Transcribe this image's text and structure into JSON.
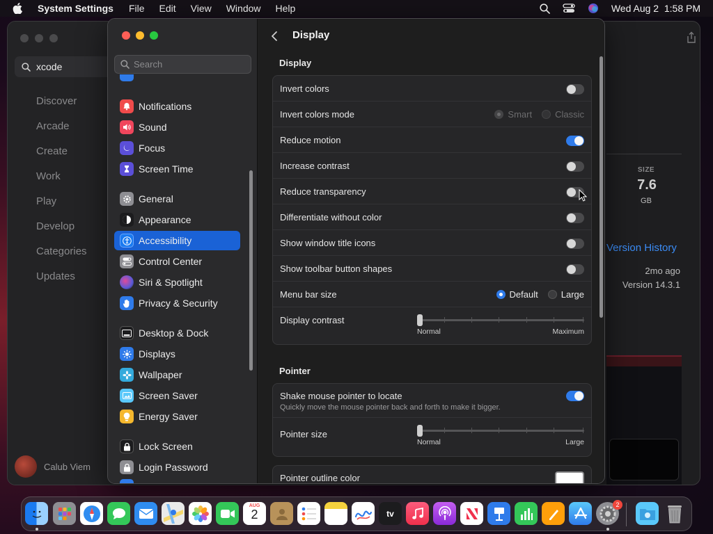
{
  "menubar": {
    "app_name": "System Settings",
    "items": [
      "File",
      "Edit",
      "View",
      "Window",
      "Help"
    ],
    "datetime": "Wed Aug 2  1:58 PM"
  },
  "background_window": {
    "search_value": "xcode",
    "nav": [
      "Discover",
      "Arcade",
      "Create",
      "Work",
      "Play",
      "Develop",
      "Categories",
      "Updates"
    ],
    "user_name": "Calub Viem",
    "size_label": "SIZE",
    "size_value": "7.6",
    "size_unit": "GB",
    "version_history": "Version History",
    "updated_ago": "2mo ago",
    "version": "Version 14.3.1"
  },
  "sidebar": {
    "search_placeholder": "Search",
    "items": [
      {
        "label": "Notifications",
        "color": "#f04b4b"
      },
      {
        "label": "Sound",
        "color": "#f0465c"
      },
      {
        "label": "Focus",
        "color": "#5b4fd8"
      },
      {
        "label": "Screen Time",
        "color": "#5b4fd8"
      },
      {
        "label": "General",
        "color": "#8e8e93"
      },
      {
        "label": "Appearance",
        "color": "#1c1c1e"
      },
      {
        "label": "Accessibility",
        "color": "#1a7af0",
        "selected": true
      },
      {
        "label": "Control Center",
        "color": "#8e8e93"
      },
      {
        "label": "Siri & Spotlight",
        "color": "#b04ad8"
      },
      {
        "label": "Privacy & Security",
        "color": "#2f7bea"
      },
      {
        "label": "Desktop & Dock",
        "color": "#1c1c1e"
      },
      {
        "label": "Displays",
        "color": "#2f7bea"
      },
      {
        "label": "Wallpaper",
        "color": "#34aadc"
      },
      {
        "label": "Screen Saver",
        "color": "#5ac8fa"
      },
      {
        "label": "Energy Saver",
        "color": "#f5b82e"
      },
      {
        "label": "Lock Screen",
        "color": "#1c1c1e"
      },
      {
        "label": "Login Password",
        "color": "#8e8e93"
      }
    ]
  },
  "main": {
    "title": "Display",
    "display_section": "Display",
    "rows": {
      "invert_colors": {
        "label": "Invert colors",
        "on": false
      },
      "invert_mode": {
        "label": "Invert colors mode",
        "options": [
          "Smart",
          "Classic"
        ],
        "selected": "Smart"
      },
      "reduce_motion": {
        "label": "Reduce motion",
        "on": true
      },
      "increase_contrast": {
        "label": "Increase contrast",
        "on": false
      },
      "reduce_transparency": {
        "label": "Reduce transparency",
        "on": false
      },
      "differentiate": {
        "label": "Differentiate without color",
        "on": false
      },
      "title_icons": {
        "label": "Show window title icons",
        "on": false
      },
      "toolbar_shapes": {
        "label": "Show toolbar button shapes",
        "on": false
      },
      "menu_bar_size": {
        "label": "Menu bar size",
        "options": [
          "Default",
          "Large"
        ],
        "selected": "Default"
      },
      "display_contrast": {
        "label": "Display contrast",
        "min_label": "Normal",
        "max_label": "Maximum",
        "value": 0
      }
    },
    "pointer_section": "Pointer",
    "pointer": {
      "shake": {
        "label": "Shake mouse pointer to locate",
        "sub": "Quickly move the mouse pointer back and forth to make it bigger.",
        "on": true
      },
      "size": {
        "label": "Pointer size",
        "min_label": "Normal",
        "max_label": "Large",
        "value": 0
      },
      "outline": {
        "label": "Pointer outline color",
        "color": "#ffffff"
      }
    }
  },
  "dock": {
    "calendar_month": "AUG",
    "calendar_day": "2",
    "tv_label": "tv",
    "settings_badge": "2"
  }
}
